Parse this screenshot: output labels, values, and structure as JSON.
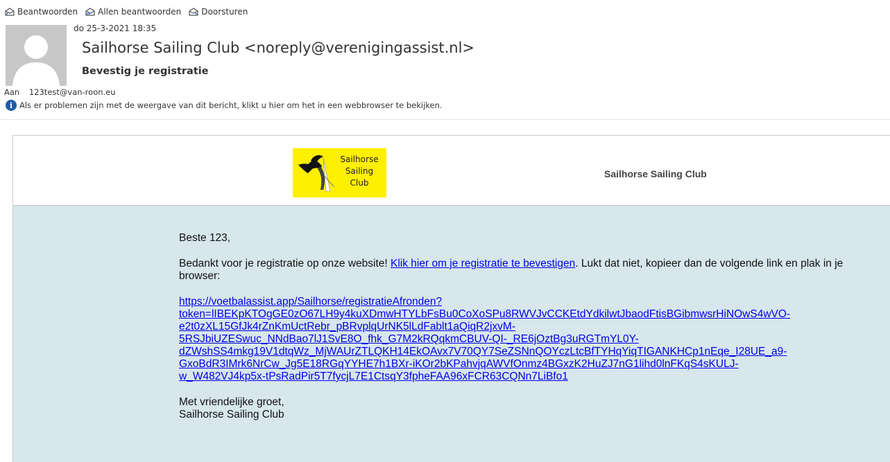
{
  "toolbar": {
    "reply": "Beantwoorden",
    "reply_all": "Allen beantwoorden",
    "forward": "Doorsturen"
  },
  "message": {
    "date": "do 25-3-2021 18:35",
    "sender": "Sailhorse Sailing Club <noreply@verenigingassist.nl>",
    "subject": "Bevestig je registratie",
    "to_label": "Aan",
    "to_address": "123test@van-roon.eu",
    "info_text": "Als er problemen zijn met de weergave van dit bericht, klikt u hier om het in een webbrowser te bekijken."
  },
  "email": {
    "logo_lines": [
      "Sailhorse",
      "Sailing",
      "Club"
    ],
    "club_title": "Sailhorse Sailing Club",
    "greeting": "Beste 123,",
    "thanks_text": "Bedankt voor je registratie op onze website! ",
    "confirm_link": "Klik hier om je registratie te bevestigen",
    "after_link": ". Lukt dat niet, kopieer dan de volgende link en plak in je browser:",
    "long_link_lines": [
      "https://voetbalassist.app/Sailhorse/registratieAfronden?",
      "token=lIBEKpKTOgGE0zO67LH9y4kuXDmwHTYLbFsBu0CoXoSPu8RWVJvCCKEtdYdkilwtJbaodFtisBGibmwsrHiNOwS4wVO-",
      "e2t0zXL15GfJk4rZnKmUctRebr_pBRvplqUrNK5lLdFablt1aQiqR2jxvM-",
      "5RSJbiUZESwuc_NNdBao7lJ1SvE8O_fhk_G7M2kRQqkmCBUV-QI-_RE6jOztBg3uRGTmYL0Y-",
      "dZWshSS4mkg19V1dtqWz_MjWAUrZTLQKH14EkOAvx7V70QY7SeZSNnQOYczLtcBfTYHqYiqTIGANKHCp1nEqe_I28UE_a9-",
      "GxoBdR3IMrk6NrCw_Jg5E18RGqYYHE7h1BXr-iKOr2bKPahvjqAWVfOnmz4BGxzK2HuZJ7nG1lihd0lnFKqS4sKULJ-",
      "w_W482VJ4kp5x-tPsRadPir5T7fycjL7E1CtsqY3fpheFAA96xFCR63CQNn7LiBfo1"
    ],
    "closing": "Met vriendelijke groet,",
    "signature": "Sailhorse Sailing Club"
  },
  "colors": {
    "body_bg": "#d7e7ec",
    "logo_bg": "#ffef00",
    "link": "#0000ee"
  }
}
